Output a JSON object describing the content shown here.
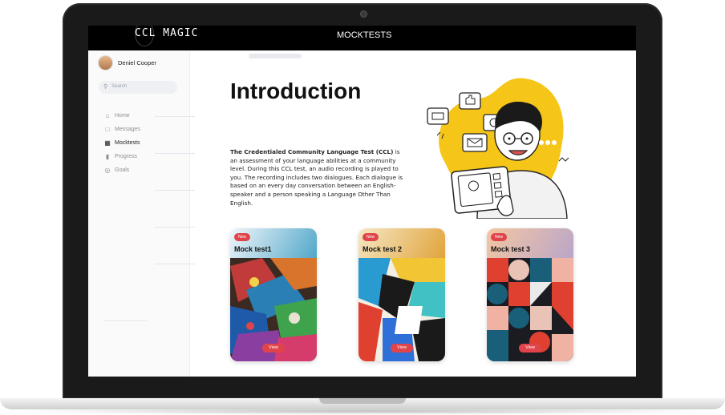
{
  "app": {
    "logo": "CCL MAGIC",
    "title": "MOCKTESTS"
  },
  "sidebar": {
    "user_name": "Deniel Cooper",
    "search_placeholder": "Search",
    "items": [
      {
        "label": "Home",
        "icon": "home-icon",
        "active": false
      },
      {
        "label": "Messages",
        "icon": "chat-icon",
        "active": false
      },
      {
        "label": "Mocktests",
        "icon": "test-icon",
        "active": true
      },
      {
        "label": "Progress",
        "icon": "bar-chart-icon",
        "active": false
      },
      {
        "label": "Goals",
        "icon": "target-icon",
        "active": false
      }
    ]
  },
  "intro": {
    "title": "Introduction",
    "text_bold": "The Credentialed Community Language Test (CCL)",
    "text_rest": " is an assessment of your language abilities at a community level. During this CCL test, an audio recording is played to you. The recording includes two dialogues. Each dialogue is based on an every day conversation between an English-speaker and a person speaking a Language Other Than English."
  },
  "cards": [
    {
      "badge": "New",
      "title": "Mock test1",
      "button": "View",
      "header_color": "#4fa6c9"
    },
    {
      "badge": "New",
      "title": "Mock test 2",
      "button": "View",
      "header_color": "#e0a33a"
    },
    {
      "badge": "New",
      "title": "Mock test 3",
      "button": "View",
      "header_color": "#c9a0a6"
    }
  ],
  "colors": {
    "accent": "#e0444a",
    "illustration_yellow": "#f5c518"
  }
}
